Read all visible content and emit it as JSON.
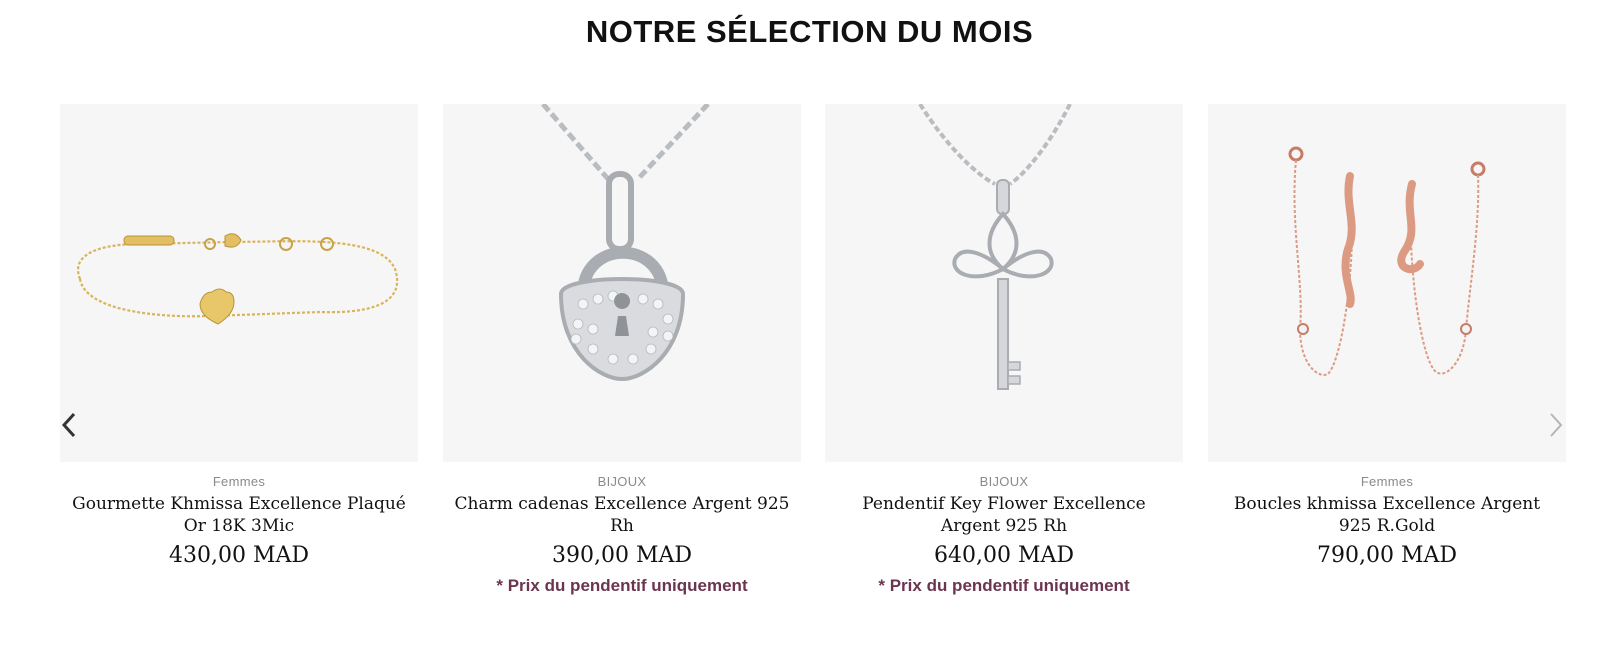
{
  "section": {
    "title": "NOTRE SÉLECTION DU MOIS"
  },
  "products": [
    {
      "category": "Femmes",
      "title": "Gourmette Khmissa Excellence Plaqué Or 18K 3Mic",
      "price": "430,00 MAD",
      "note": ""
    },
    {
      "category": "BIJOUX",
      "title": "Charm cadenas Excellence Argent 925 Rh",
      "price": "390,00 MAD",
      "note": "* Prix du pendentif uniquement"
    },
    {
      "category": "BIJOUX",
      "title": "Pendentif Key Flower Excellence Argent 925 Rh",
      "price": "640,00 MAD",
      "note": "* Prix du pendentif uniquement"
    },
    {
      "category": "Femmes",
      "title": "Boucles khmissa Excellence Argent 925 R.Gold",
      "price": "790,00 MAD",
      "note": ""
    }
  ],
  "carousel": {
    "prev_icon": "chevron-left-icon",
    "next_icon": "chevron-right-icon"
  },
  "colors": {
    "note": "#6b3550",
    "card_bg": "#f6f6f6",
    "gold": "#d9b45a",
    "silver": "#b9bcc0",
    "rose_gold": "#dc9a82"
  }
}
